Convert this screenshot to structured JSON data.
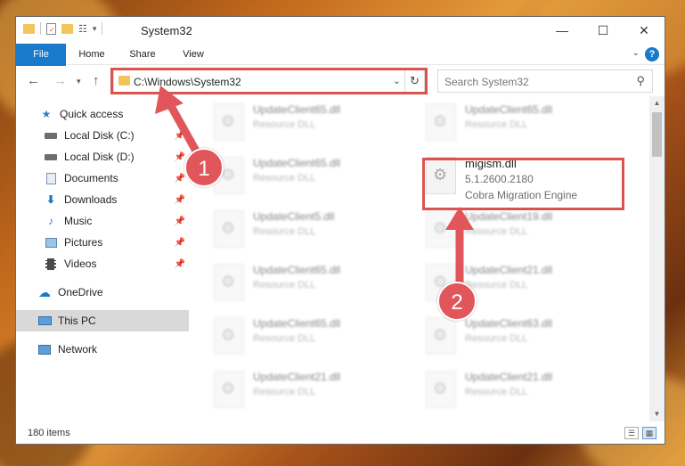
{
  "window": {
    "title": "System32",
    "controls": {
      "minimize": "—",
      "maximize": "☐",
      "close": "✕"
    }
  },
  "ribbon": {
    "tabs": [
      "File",
      "Home",
      "Share",
      "View"
    ],
    "help": "?"
  },
  "navigation": {
    "address": "C:\\Windows\\System32",
    "search_placeholder": "Search System32"
  },
  "sidebar": {
    "items": [
      {
        "label": "Quick access",
        "icon": "star-icon",
        "pinned": false
      },
      {
        "label": "Local Disk (C:)",
        "icon": "drive-icon",
        "pinned": true
      },
      {
        "label": "Local Disk (D:)",
        "icon": "drive-icon",
        "pinned": true
      },
      {
        "label": "Documents",
        "icon": "document-icon",
        "pinned": true
      },
      {
        "label": "Downloads",
        "icon": "download-icon",
        "pinned": true
      },
      {
        "label": "Music",
        "icon": "music-icon",
        "pinned": true
      },
      {
        "label": "Pictures",
        "icon": "pictures-icon",
        "pinned": true
      },
      {
        "label": "Videos",
        "icon": "video-icon",
        "pinned": true
      },
      {
        "label": "OneDrive",
        "icon": "cloud-icon",
        "pinned": false
      },
      {
        "label": "This PC",
        "icon": "computer-icon",
        "pinned": false,
        "selected": true
      },
      {
        "label": "Network",
        "icon": "network-icon",
        "pinned": false
      }
    ]
  },
  "files": [
    {
      "name": "UpdateClient65.dll",
      "type": "Resource DLL"
    },
    {
      "name": "UpdateClient65.dll",
      "type": "Resource DLL"
    },
    {
      "name": "UpdateClient65.dll",
      "type": "Resource DLL"
    },
    {
      "name": "migism.dll",
      "version": "5.1.2600.2180",
      "description": "Cobra Migration Engine",
      "highlighted": true
    },
    {
      "name": "UpdateClient5.dll",
      "type": "Resource DLL"
    },
    {
      "name": "UpdateClient19.dll",
      "type": "Resource DLL"
    },
    {
      "name": "UpdateClient65.dll",
      "type": "Resource DLL"
    },
    {
      "name": "UpdateClient21.dll",
      "type": "Resource DLL"
    },
    {
      "name": "UpdateClient65.dll",
      "type": "Resource DLL"
    },
    {
      "name": "UpdateClient63.dll",
      "type": "Resource DLL"
    },
    {
      "name": "UpdateClient21.dll",
      "type": "Resource DLL"
    },
    {
      "name": "UpdateClient21.dll",
      "type": "Resource DLL"
    }
  ],
  "status": {
    "item_count": "180 items"
  },
  "annotations": {
    "step1": "1",
    "step2": "2",
    "color": "#e0565b"
  }
}
